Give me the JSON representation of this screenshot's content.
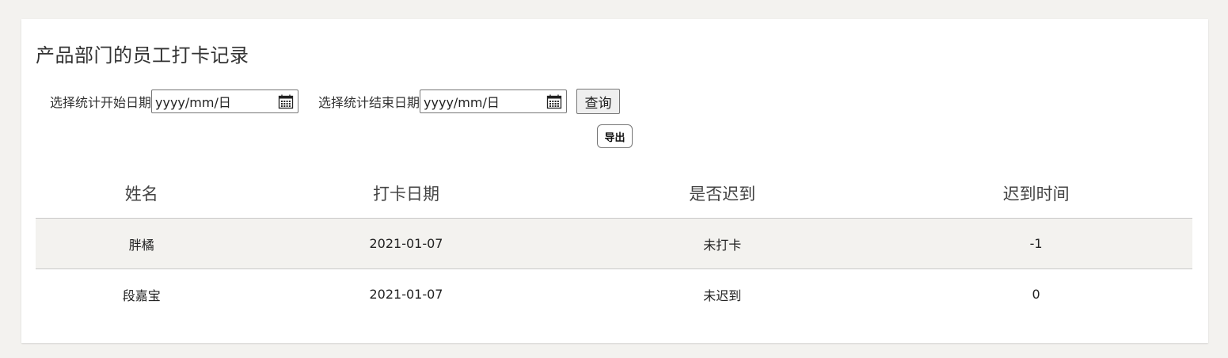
{
  "header": {
    "title": "产品部门的员工打卡记录"
  },
  "filters": {
    "start_label": "选择统计开始日期",
    "start_placeholder": "yyyy/mm/日",
    "end_label": "选择统计结束日期",
    "end_placeholder": "yyyy/mm/日",
    "query_label": "查询",
    "export_label": "导出"
  },
  "table": {
    "columns": [
      "姓名",
      "打卡日期",
      "是否迟到",
      "迟到时间"
    ],
    "rows": [
      [
        "胖橘",
        "2021-01-07",
        "未打卡",
        "-1"
      ],
      [
        "段嘉宝",
        "2021-01-07",
        "未迟到",
        "0"
      ]
    ]
  },
  "icons": {
    "calendar": "calendar-icon"
  },
  "colors": {
    "background": "#f3f2ef",
    "panel": "#ffffff",
    "striped_row": "#f3f2ef"
  }
}
